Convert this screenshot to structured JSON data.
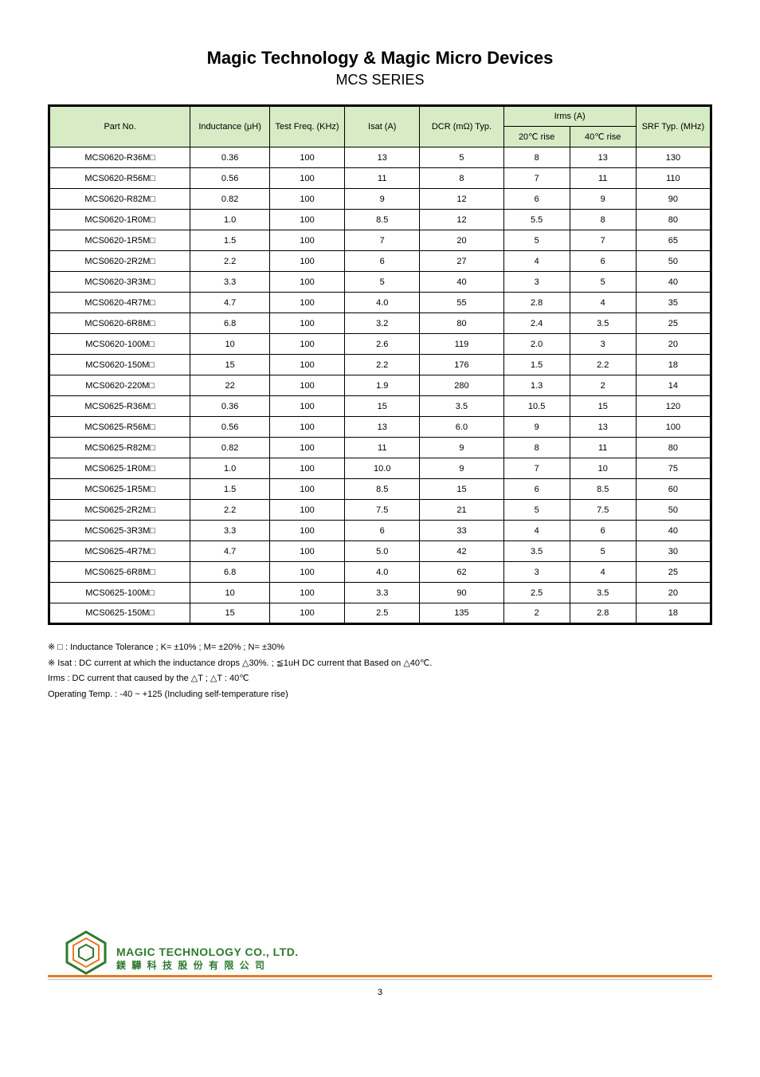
{
  "title": "Magic Technology & Magic Micro Devices",
  "series": "MCS SERIES",
  "headers": {
    "part_no": "Part No.",
    "inductance": "Inductance (μH)",
    "test_freq": "Test Freq. (KHz)",
    "isat": "Isat (A)",
    "dcr_typ": "DCR (mΩ) Typ.",
    "irms_group": "Irms (A)",
    "irms20": "20℃ rise",
    "irms40": "40℃ rise",
    "srf": "SRF Typ. (MHz)"
  },
  "rows": [
    {
      "part": "MCS0620-R36M□",
      "ind": "0.36",
      "freq": "100",
      "isat": "13",
      "dcr": "5",
      "i20": "8",
      "i40": "13",
      "srf": "130"
    },
    {
      "part": "MCS0620-R56M□",
      "ind": "0.56",
      "freq": "100",
      "isat": "11",
      "dcr": "8",
      "i20": "7",
      "i40": "11",
      "srf": "110"
    },
    {
      "part": "MCS0620-R82M□",
      "ind": "0.82",
      "freq": "100",
      "isat": "9",
      "dcr": "12",
      "i20": "6",
      "i40": "9",
      "srf": "90"
    },
    {
      "part": "MCS0620-1R0M□",
      "ind": "1.0",
      "freq": "100",
      "isat": "8.5",
      "dcr": "12",
      "i20": "5.5",
      "i40": "8",
      "srf": "80"
    },
    {
      "part": "MCS0620-1R5M□",
      "ind": "1.5",
      "freq": "100",
      "isat": "7",
      "dcr": "20",
      "i20": "5",
      "i40": "7",
      "srf": "65"
    },
    {
      "part": "MCS0620-2R2M□",
      "ind": "2.2",
      "freq": "100",
      "isat": "6",
      "dcr": "27",
      "i20": "4",
      "i40": "6",
      "srf": "50"
    },
    {
      "part": "MCS0620-3R3M□",
      "ind": "3.3",
      "freq": "100",
      "isat": "5",
      "dcr": "40",
      "i20": "3",
      "i40": "5",
      "srf": "40"
    },
    {
      "part": "MCS0620-4R7M□",
      "ind": "4.7",
      "freq": "100",
      "isat": "4.0",
      "dcr": "55",
      "i20": "2.8",
      "i40": "4",
      "srf": "35"
    },
    {
      "part": "MCS0620-6R8M□",
      "ind": "6.8",
      "freq": "100",
      "isat": "3.2",
      "dcr": "80",
      "i20": "2.4",
      "i40": "3.5",
      "srf": "25"
    },
    {
      "part": "MCS0620-100M□",
      "ind": "10",
      "freq": "100",
      "isat": "2.6",
      "dcr": "119",
      "i20": "2.0",
      "i40": "3",
      "srf": "20"
    },
    {
      "part": "MCS0620-150M□",
      "ind": "15",
      "freq": "100",
      "isat": "2.2",
      "dcr": "176",
      "i20": "1.5",
      "i40": "2.2",
      "srf": "18"
    },
    {
      "part": "MCS0620-220M□",
      "ind": "22",
      "freq": "100",
      "isat": "1.9",
      "dcr": "280",
      "i20": "1.3",
      "i40": "2",
      "srf": "14"
    },
    {
      "part": "MCS0625-R36M□",
      "ind": "0.36",
      "freq": "100",
      "isat": "15",
      "dcr": "3.5",
      "i20": "10.5",
      "i40": "15",
      "srf": "120"
    },
    {
      "part": "MCS0625-R56M□",
      "ind": "0.56",
      "freq": "100",
      "isat": "13",
      "dcr": "6.0",
      "i20": "9",
      "i40": "13",
      "srf": "100"
    },
    {
      "part": "MCS0625-R82M□",
      "ind": "0.82",
      "freq": "100",
      "isat": "11",
      "dcr": "9",
      "i20": "8",
      "i40": "11",
      "srf": "80"
    },
    {
      "part": "MCS0625-1R0M□",
      "ind": "1.0",
      "freq": "100",
      "isat": "10.0",
      "dcr": "9",
      "i20": "7",
      "i40": "10",
      "srf": "75"
    },
    {
      "part": "MCS0625-1R5M□",
      "ind": "1.5",
      "freq": "100",
      "isat": "8.5",
      "dcr": "15",
      "i20": "6",
      "i40": "8.5",
      "srf": "60"
    },
    {
      "part": "MCS0625-2R2M□",
      "ind": "2.2",
      "freq": "100",
      "isat": "7.5",
      "dcr": "21",
      "i20": "5",
      "i40": "7.5",
      "srf": "50"
    },
    {
      "part": "MCS0625-3R3M□",
      "ind": "3.3",
      "freq": "100",
      "isat": "6",
      "dcr": "33",
      "i20": "4",
      "i40": "6",
      "srf": "40"
    },
    {
      "part": "MCS0625-4R7M□",
      "ind": "4.7",
      "freq": "100",
      "isat": "5.0",
      "dcr": "42",
      "i20": "3.5",
      "i40": "5",
      "srf": "30"
    },
    {
      "part": "MCS0625-6R8M□",
      "ind": "6.8",
      "freq": "100",
      "isat": "4.0",
      "dcr": "62",
      "i20": "3",
      "i40": "4",
      "srf": "25"
    },
    {
      "part": "MCS0625-100M□",
      "ind": "10",
      "freq": "100",
      "isat": "3.3",
      "dcr": "90",
      "i20": "2.5",
      "i40": "3.5",
      "srf": "20"
    },
    {
      "part": "MCS0625-150M□",
      "ind": "15",
      "freq": "100",
      "isat": "2.5",
      "dcr": "135",
      "i20": "2",
      "i40": "2.8",
      "srf": "18"
    }
  ],
  "notes": {
    "n1": "※ □ : Inductance Tolerance ; K= ±10% ; M= ±20% ; N= ±30%",
    "n2": "※ Isat : DC current at which the inductance drops △30%. ; ≦1uH DC current that Based on △40℃.",
    "n3": "   Irms : DC current that caused by the △T ; △T : 40℃",
    "n4": "   Operating Temp. :  -40 ~ +125 (Including self-temperature rise)"
  },
  "company_en": "MAGIC TECHNOLOGY CO., LTD.",
  "company_cn": "鎂 驊 科 技 股 份 有 限 公 司",
  "page_num": "3"
}
